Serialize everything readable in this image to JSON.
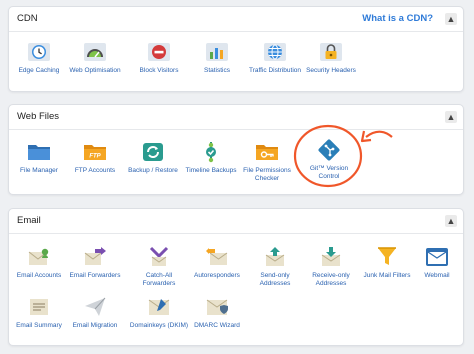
{
  "sections": {
    "cdn": {
      "title": "CDN",
      "link": "What is a CDN?",
      "collapse": "▲",
      "items": [
        {
          "label": "Edge Caching"
        },
        {
          "label": "Web Optimisation"
        },
        {
          "label": "Block Visitors"
        },
        {
          "label": "Statistics"
        },
        {
          "label": "Traffic Distribution"
        },
        {
          "label": "Security Headers"
        }
      ]
    },
    "web_files": {
      "title": "Web Files",
      "collapse": "▲",
      "items": [
        {
          "label": "File Manager"
        },
        {
          "label": "FTP Accounts"
        },
        {
          "label": "Backup / Restore"
        },
        {
          "label": "Timeline Backups"
        },
        {
          "label": "File Permissions Checker"
        },
        {
          "label": "Git™ Version Control"
        }
      ],
      "ftp_icon_text": "FTP"
    },
    "email": {
      "title": "Email",
      "collapse": "▲",
      "items": [
        {
          "label": "Email Accounts"
        },
        {
          "label": "Email Forwarders"
        },
        {
          "label": "Catch-All Forwarders"
        },
        {
          "label": "Autoresponders"
        },
        {
          "label": "Send-only Addresses"
        },
        {
          "label": "Receive-only Addresses"
        },
        {
          "label": "Junk Mail Filters"
        },
        {
          "label": "Webmail"
        },
        {
          "label": "Email Summary"
        },
        {
          "label": "Email Migration"
        },
        {
          "label": "Domainkeys (DKIM)"
        },
        {
          "label": "DMARC Wizard"
        }
      ]
    }
  },
  "colors": {
    "link": "#2f7bd8",
    "label": "#2b62b0",
    "annotation": "#f0572a",
    "folder": "#f5a623",
    "git": "#2a7fb8"
  }
}
